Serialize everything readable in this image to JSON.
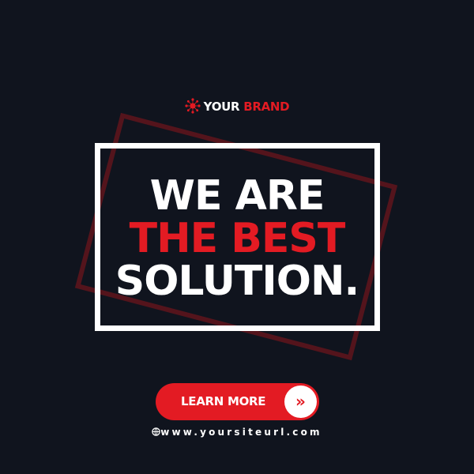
{
  "brand": {
    "word1": "YOUR",
    "word2": "BRAND",
    "icon": "network-burst-icon"
  },
  "headline": {
    "line1": "WE ARE",
    "line2": "THE BEST",
    "line3": "SOLUTION."
  },
  "cta": {
    "label": "LEARN MORE",
    "icon": "double-chevron-right-icon",
    "icon_glyph": "»"
  },
  "footer": {
    "url": "www.yoursiteurl.com",
    "icon": "globe-icon"
  },
  "colors": {
    "background": "#10141e",
    "accent": "#e31b23",
    "text": "#ffffff"
  }
}
